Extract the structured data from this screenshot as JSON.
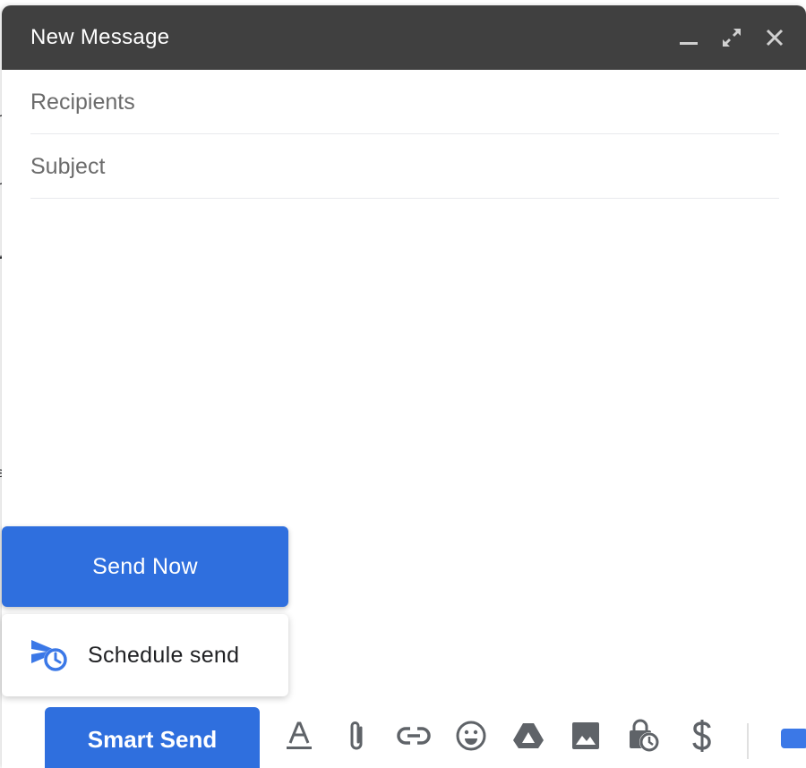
{
  "window": {
    "title": "New Message",
    "controls": {
      "minimize": "minimize-icon",
      "expand": "expand-icon",
      "close": "close-icon"
    }
  },
  "fields": {
    "recipients": {
      "placeholder": "Recipients",
      "value": ""
    },
    "subject": {
      "placeholder": "Subject",
      "value": ""
    }
  },
  "send_menu": {
    "send_now_label": "Send Now",
    "schedule_label": "Schedule send",
    "schedule_icon": "schedule-send-icon"
  },
  "toolbar": {
    "smart_send_label": "Smart Send",
    "tools": [
      "format-text-icon",
      "attach-icon",
      "link-icon",
      "emoji-icon",
      "drive-icon",
      "photo-icon",
      "confidential-mode-icon",
      "money-icon"
    ]
  },
  "colors": {
    "accent": "#2f6fde",
    "titlebar": "#404040",
    "icon_gray": "#5f6368"
  }
}
